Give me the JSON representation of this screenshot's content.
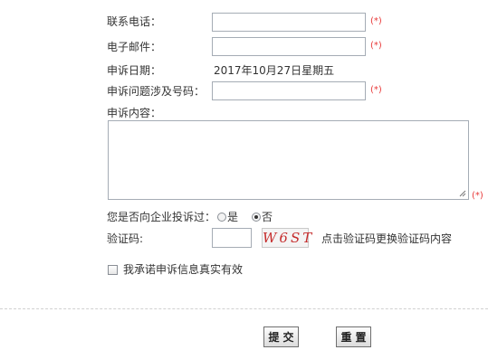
{
  "form": {
    "phone_label": "联系电话：",
    "email_label": "电子邮件：",
    "date_label": "申诉日期：",
    "date_value": "2017年10月27日星期五",
    "issue_number_label": "申诉问题涉及号码：",
    "content_label": "申诉内容：",
    "required_mark": "(*)",
    "phone_value": "",
    "email_value": "",
    "issue_number_value": "",
    "content_value": "",
    "complained_label": "您是否向企业投诉过：",
    "complained_options": [
      "是",
      "否"
    ],
    "complained_selected": "否",
    "captcha_label": "验证码:",
    "captcha_value": "",
    "captcha_code": "W6ST",
    "captcha_hint": "点击验证码更换验证码内容",
    "promise_label": "我承诺申诉信息真实有效",
    "promise_checked": false
  },
  "buttons": {
    "submit_label": "提交",
    "reset_label": "重置"
  }
}
